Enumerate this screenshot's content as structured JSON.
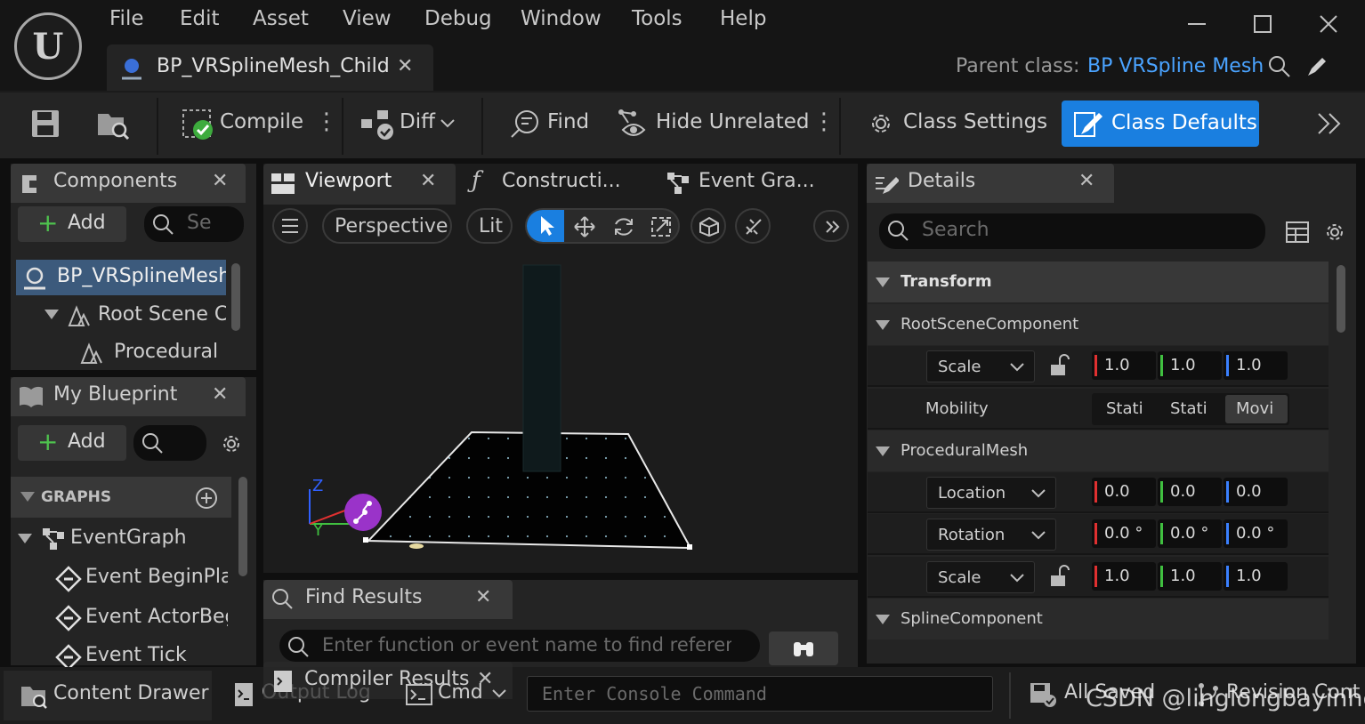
{
  "menu": [
    "File",
    "Edit",
    "Asset",
    "View",
    "Debug",
    "Window",
    "Tools",
    "Help"
  ],
  "asset_tab": {
    "label": "BP_VRSplineMesh_Child"
  },
  "parent_class": {
    "label": "Parent class:",
    "value": "BP VRSpline Mesh"
  },
  "toolbar": {
    "compile": "Compile",
    "diff": "Diff",
    "find": "Find",
    "hide_unrelated": "Hide Unrelated",
    "class_settings": "Class Settings",
    "class_defaults": "Class Defaults"
  },
  "components": {
    "title": "Components",
    "add": "Add",
    "search_placeholder": "Se",
    "tree": [
      "BP_VRSplineMesh",
      "Root Scene Co",
      "Procedural M"
    ]
  },
  "my_blueprint": {
    "title": "My Blueprint",
    "add": "Add",
    "graphs_header": "GRAPHS",
    "event_graph": "EventGraph",
    "events": [
      "Event BeginPla",
      "Event ActorBeg",
      "Event Tick"
    ]
  },
  "center_tabs": {
    "viewport": "Viewport",
    "construction": "Constructi...",
    "event_graph": "Event Gra..."
  },
  "viewport": {
    "perspective": "Perspective",
    "lit": "Lit",
    "axis_z": "Z",
    "axis_y": "Y"
  },
  "find_results": {
    "title": "Find Results",
    "placeholder": "Enter function or event name to find referenc"
  },
  "compiler_results": {
    "title": "Compiler Results"
  },
  "details": {
    "title": "Details",
    "search_placeholder": "Search",
    "sections": {
      "transform": "Transform",
      "root_scene": "RootSceneComponent",
      "procedural_mesh": "ProceduralMesh",
      "spline": "SplineComponent"
    },
    "root_scale": {
      "label": "Scale",
      "values": [
        "1.0",
        "1.0",
        "1.0"
      ]
    },
    "mobility": {
      "label": "Mobility",
      "options": [
        "Stati",
        "Stati",
        "Movi"
      ]
    },
    "pm_location": {
      "label": "Location",
      "values": [
        "0.0",
        "0.0",
        "0.0"
      ]
    },
    "pm_rotation": {
      "label": "Rotation",
      "values": [
        "0.0 °",
        "0.0 °",
        "0.0 °"
      ]
    },
    "pm_scale": {
      "label": "Scale",
      "values": [
        "1.0",
        "1.0",
        "1.0"
      ]
    }
  },
  "bottom": {
    "content_drawer": "Content Drawer",
    "output_log": "Output Log",
    "cmd": "Cmd",
    "console_placeholder": "Enter Console Command",
    "all_saved": "All Saved",
    "revision": "Revision Contr"
  },
  "watermark": "CSDN @linglongbayinhe",
  "colors": {
    "accent": "#1a7fe0",
    "link": "#4aa3ff",
    "x_axis": "#e03030",
    "y_axis": "#40c040",
    "z_axis": "#3060ff"
  }
}
